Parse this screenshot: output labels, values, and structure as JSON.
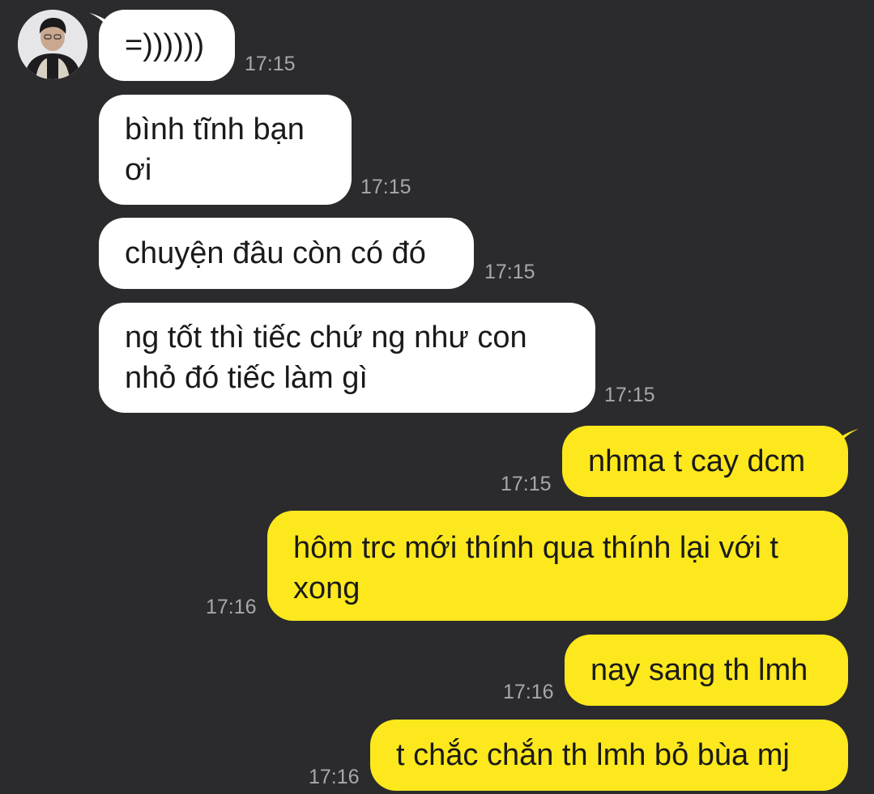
{
  "conversation": {
    "messages": [
      {
        "direction": "incoming",
        "text": "=))))))",
        "time": "17:15"
      },
      {
        "direction": "incoming",
        "text": "bình tĩnh bạn\nơi",
        "time": "17:15"
      },
      {
        "direction": "incoming",
        "text": "chuyện đâu còn có đó",
        "time": "17:15"
      },
      {
        "direction": "incoming",
        "text": "ng tốt thì tiếc chứ ng như con\nnhỏ đó tiếc làm gì",
        "time": "17:15"
      },
      {
        "direction": "outgoing",
        "text": "nhma t cay dcm",
        "time": "17:15"
      },
      {
        "direction": "outgoing",
        "text": "hôm trc mới thính qua thính lại với t\nxong",
        "time": "17:16"
      },
      {
        "direction": "outgoing",
        "text": "nay sang th lmh",
        "time": "17:16"
      },
      {
        "direction": "outgoing",
        "text": "t chắc chắn th lmh bỏ bùa mj",
        "time": "17:16"
      }
    ]
  },
  "colors": {
    "background": "#2b2b2d",
    "incoming_bubble": "#ffffff",
    "outgoing_bubble": "#fde81d",
    "timestamp": "#a8a8ab"
  }
}
